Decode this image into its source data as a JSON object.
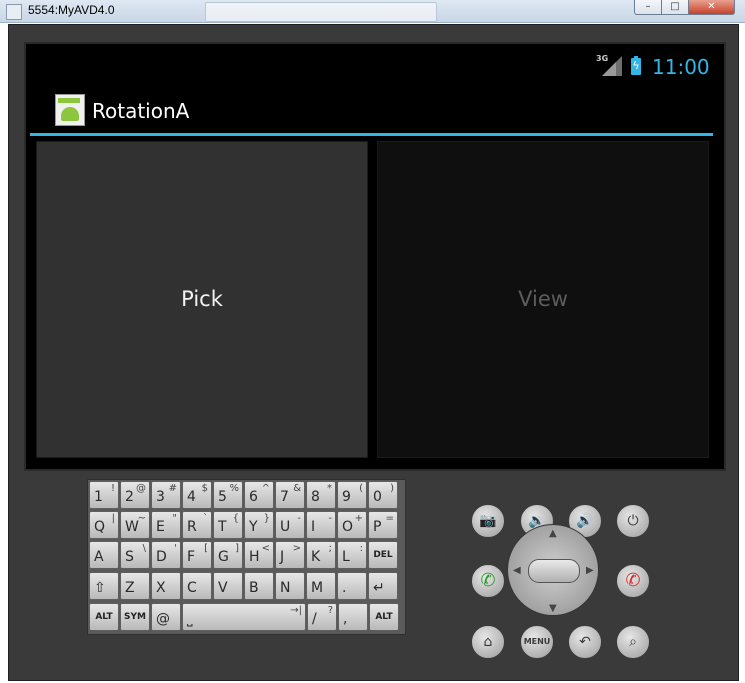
{
  "window": {
    "title": "5554:MyAVD4.0"
  },
  "status_bar": {
    "network": "3G",
    "time": "11:00"
  },
  "action_bar": {
    "title": "RotationA"
  },
  "panes": {
    "pick_label": "Pick",
    "view_label": "View"
  },
  "keyboard": {
    "row1": [
      [
        "1",
        "!"
      ],
      [
        "2",
        "@"
      ],
      [
        "3",
        "#"
      ],
      [
        "4",
        "$"
      ],
      [
        "5",
        "%"
      ],
      [
        "6",
        "^"
      ],
      [
        "7",
        "&"
      ],
      [
        "8",
        "*"
      ],
      [
        "9",
        "("
      ],
      [
        "0",
        ")"
      ]
    ],
    "row2": [
      [
        "Q",
        "|"
      ],
      [
        "W",
        "~"
      ],
      [
        "E",
        "\""
      ],
      [
        "R",
        "`"
      ],
      [
        "T",
        "{"
      ],
      [
        "Y",
        "}"
      ],
      [
        "U",
        "-"
      ],
      [
        "I",
        "-"
      ],
      [
        "O",
        "+"
      ],
      [
        "P",
        "="
      ]
    ],
    "row3": [
      [
        "A",
        ""
      ],
      [
        "S",
        "\\"
      ],
      [
        "D",
        "'"
      ],
      [
        "F",
        "["
      ],
      [
        "G",
        "]"
      ],
      [
        "H",
        "<"
      ],
      [
        "J",
        ">"
      ],
      [
        "K",
        ";"
      ],
      [
        "L",
        ":"
      ],
      [
        "DEL",
        ""
      ]
    ],
    "row4": [
      [
        "⇧",
        ""
      ],
      [
        "Z",
        ""
      ],
      [
        "X",
        ""
      ],
      [
        "C",
        ""
      ],
      [
        "V",
        ""
      ],
      [
        "B",
        ""
      ],
      [
        "N",
        ""
      ],
      [
        "M",
        ""
      ],
      [
        ".",
        ""
      ],
      [
        "↵",
        ""
      ]
    ],
    "row5": [
      [
        "ALT",
        ""
      ],
      [
        "SYM",
        ""
      ],
      [
        "@",
        ""
      ],
      [
        "space",
        "→|"
      ],
      [
        "/",
        "?"
      ],
      [
        ",",
        ""
      ],
      [
        "ALT",
        ""
      ]
    ]
  },
  "controls": {
    "camera": "📷",
    "vol_down": "🔉",
    "vol_up": "🔊",
    "power": "⏻",
    "call": "✆",
    "end_call": "✆",
    "home": "⌂",
    "menu": "MENU",
    "back": "↶",
    "search": "⌕"
  },
  "colors": {
    "accent": "#33b5e5",
    "pick_bg": "#313131",
    "view_bg": "#0f0f0f"
  }
}
